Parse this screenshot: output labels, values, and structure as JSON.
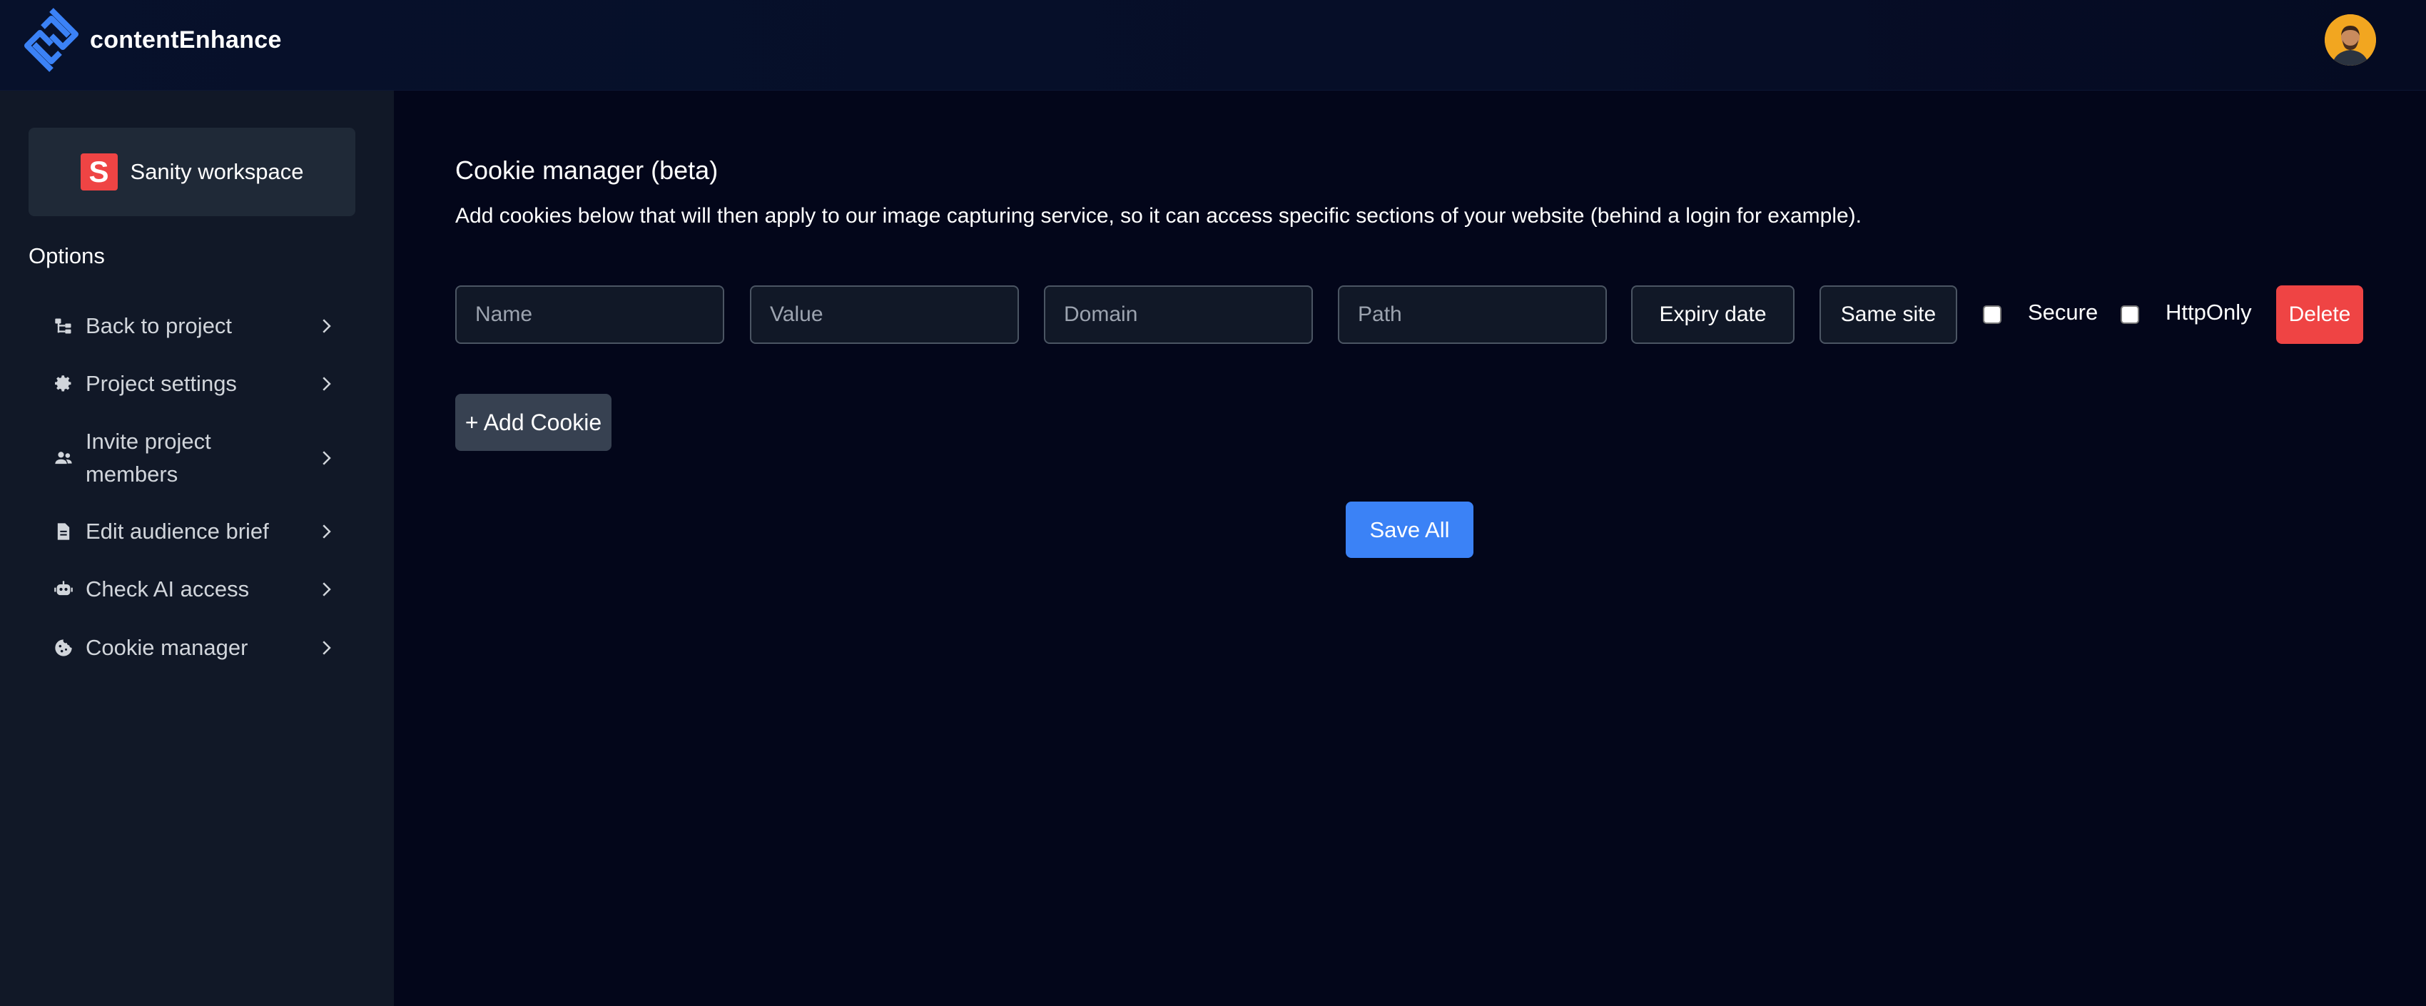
{
  "app": {
    "brand": "contentEnhance",
    "accent": "#3b82f6",
    "brand_icon": "content-enhance-logo-icon"
  },
  "user": {
    "avatar_icon": "user-avatar"
  },
  "sidebar": {
    "workspace": {
      "name": "Sanity workspace",
      "logo_letter": "S",
      "logo_color": "#ef4444"
    },
    "options_label": "Options",
    "items": [
      {
        "label": "Back to project",
        "icon": "hierarchy-icon"
      },
      {
        "label": "Project settings",
        "icon": "gear-icon"
      },
      {
        "label": "Invite project members",
        "icon": "people-icon"
      },
      {
        "label": "Edit audience brief",
        "icon": "document-icon"
      },
      {
        "label": "Check AI access",
        "icon": "robot-icon"
      },
      {
        "label": "Cookie manager",
        "icon": "cookie-icon"
      }
    ]
  },
  "main": {
    "title": "Cookie manager (beta)",
    "description": "Add cookies below that will then apply to our image capturing service, so it can access specific sections of your website (behind a login for example).",
    "cookie_row": {
      "name_placeholder": "Name",
      "value_placeholder": "Value",
      "domain_placeholder": "Domain",
      "path_placeholder": "Path",
      "expiry_label": "Expiry date",
      "same_site_label": "Same site",
      "secure_label": "Secure",
      "secure_checked": false,
      "httponly_label": "HttpOnly",
      "httponly_checked": false,
      "delete_label": "Delete"
    },
    "add_cookie_label": "+ Add Cookie",
    "save_all_label": "Save All"
  }
}
